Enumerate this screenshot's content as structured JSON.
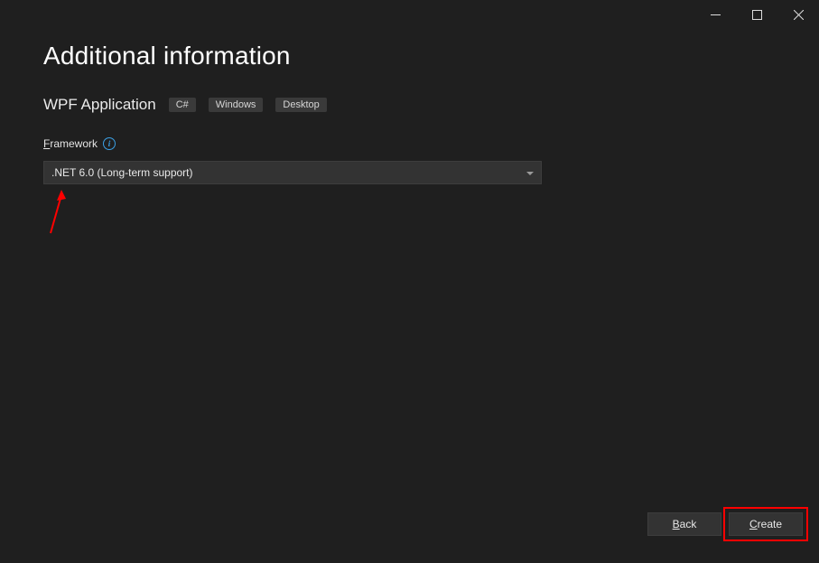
{
  "window": {
    "title": "",
    "controls": {
      "minimize": "minimize",
      "maximize": "maximize",
      "close": "close"
    }
  },
  "heading": "Additional information",
  "project": {
    "name": "WPF Application",
    "tags": [
      "C#",
      "Windows",
      "Desktop"
    ]
  },
  "framework": {
    "label_prefix": "F",
    "label_rest": "ramework",
    "selected": ".NET 6.0 (Long-term support)"
  },
  "buttons": {
    "back_prefix": "B",
    "back_rest": "ack",
    "create_prefix": "C",
    "create_rest": "reate"
  },
  "annotations": {
    "arrow_color": "#ff0000",
    "highlight_target": "create-button"
  }
}
